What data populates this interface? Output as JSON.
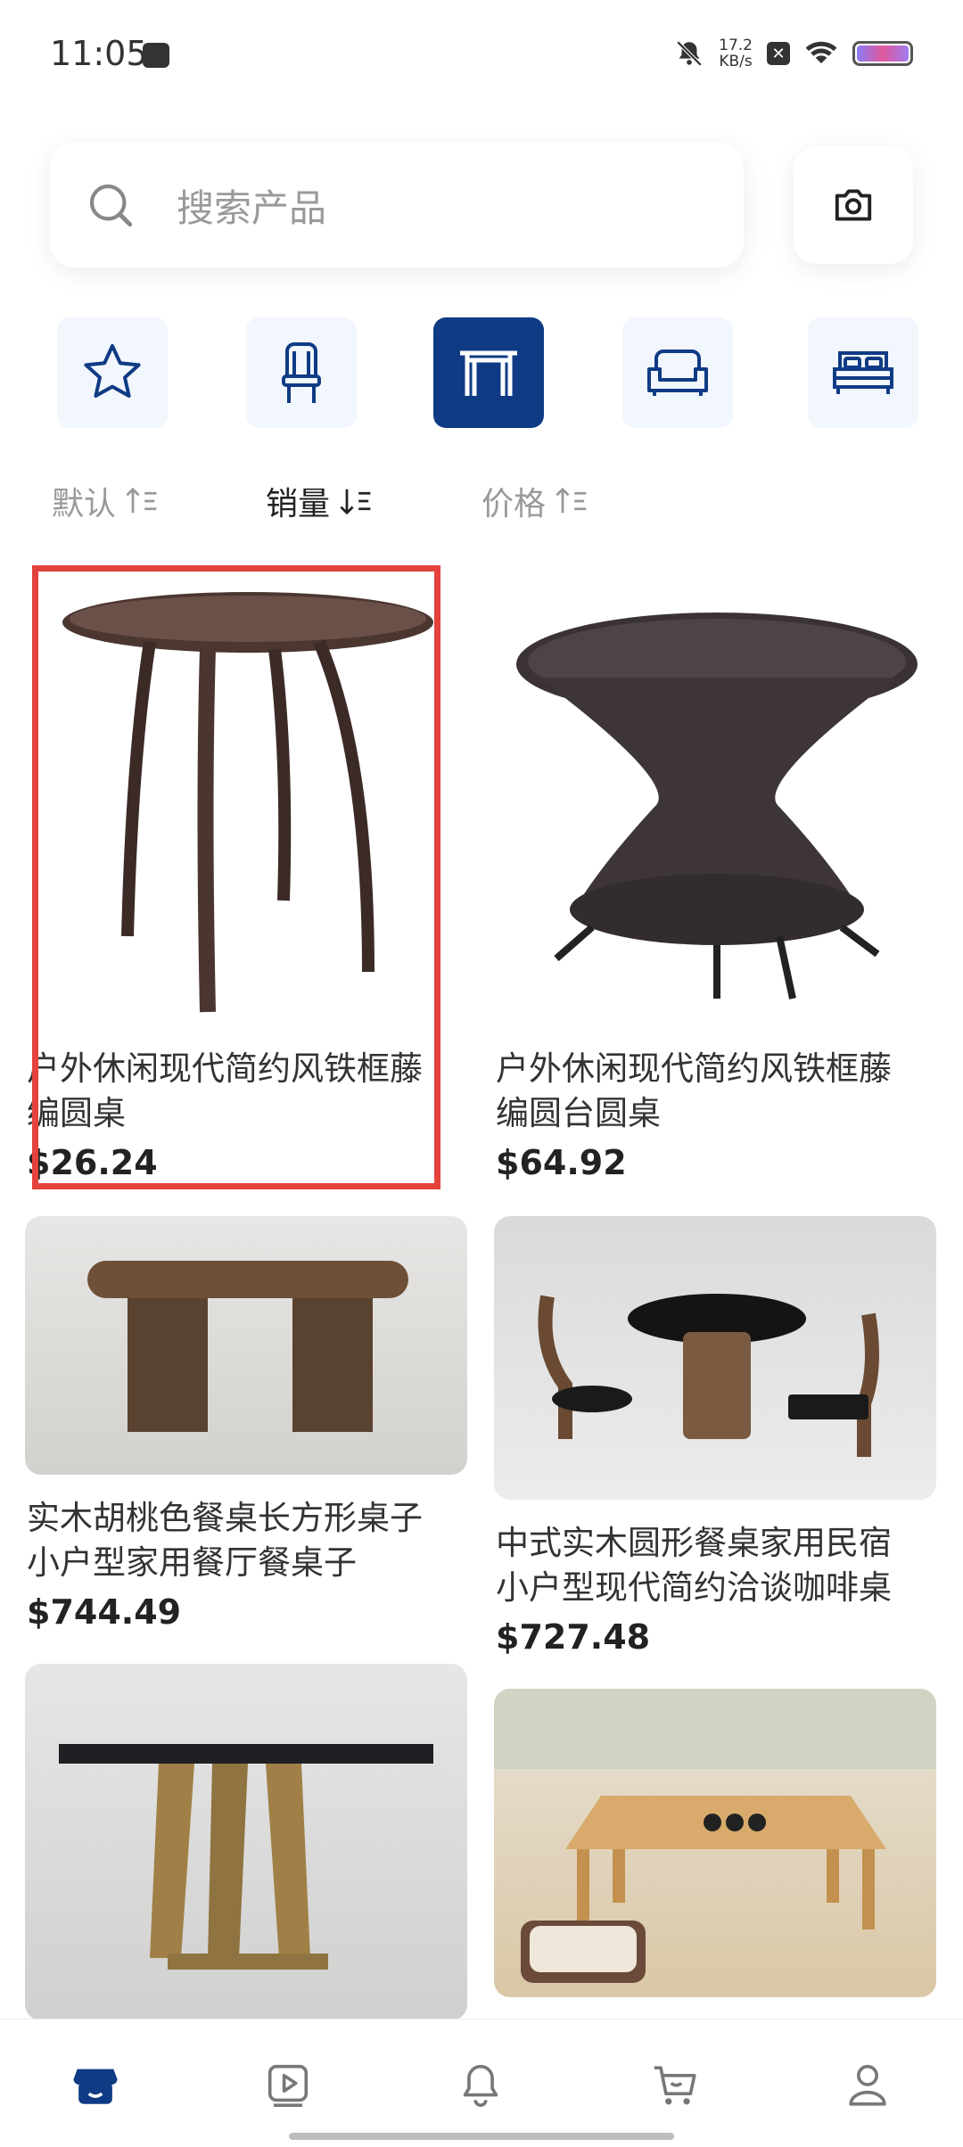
{
  "status": {
    "time": "11:05",
    "net_speed": "17.2",
    "net_unit": "KB/s"
  },
  "search": {
    "placeholder": "搜索产品"
  },
  "categories": [
    {
      "icon": "star-icon",
      "active": false
    },
    {
      "icon": "chair-icon",
      "active": false
    },
    {
      "icon": "table-icon",
      "active": true
    },
    {
      "icon": "sofa-icon",
      "active": false
    },
    {
      "icon": "bed-icon",
      "active": false
    }
  ],
  "sort": {
    "default_label": "默认",
    "sales_label": "销量",
    "price_label": "价格",
    "active": "sales"
  },
  "products": [
    {
      "title_line1": "户外休闲现代简约风铁框藤",
      "title_line2": "编圆桌",
      "price": "$26.24"
    },
    {
      "title_line1": "户外休闲现代简约风铁框藤",
      "title_line2": "编圆台圆桌",
      "price": "$64.92"
    },
    {
      "title_line1": "实木胡桃色餐桌长方形桌子",
      "title_line2": "小户型家用餐厅餐桌子",
      "price": "$744.49"
    },
    {
      "title_line1": "中式实木圆形餐桌家用民宿",
      "title_line2": "小户型现代简约洽谈咖啡桌",
      "price": "$727.48"
    }
  ],
  "colors": {
    "accent": "#0f3b85",
    "highlight": "#e5423d"
  }
}
